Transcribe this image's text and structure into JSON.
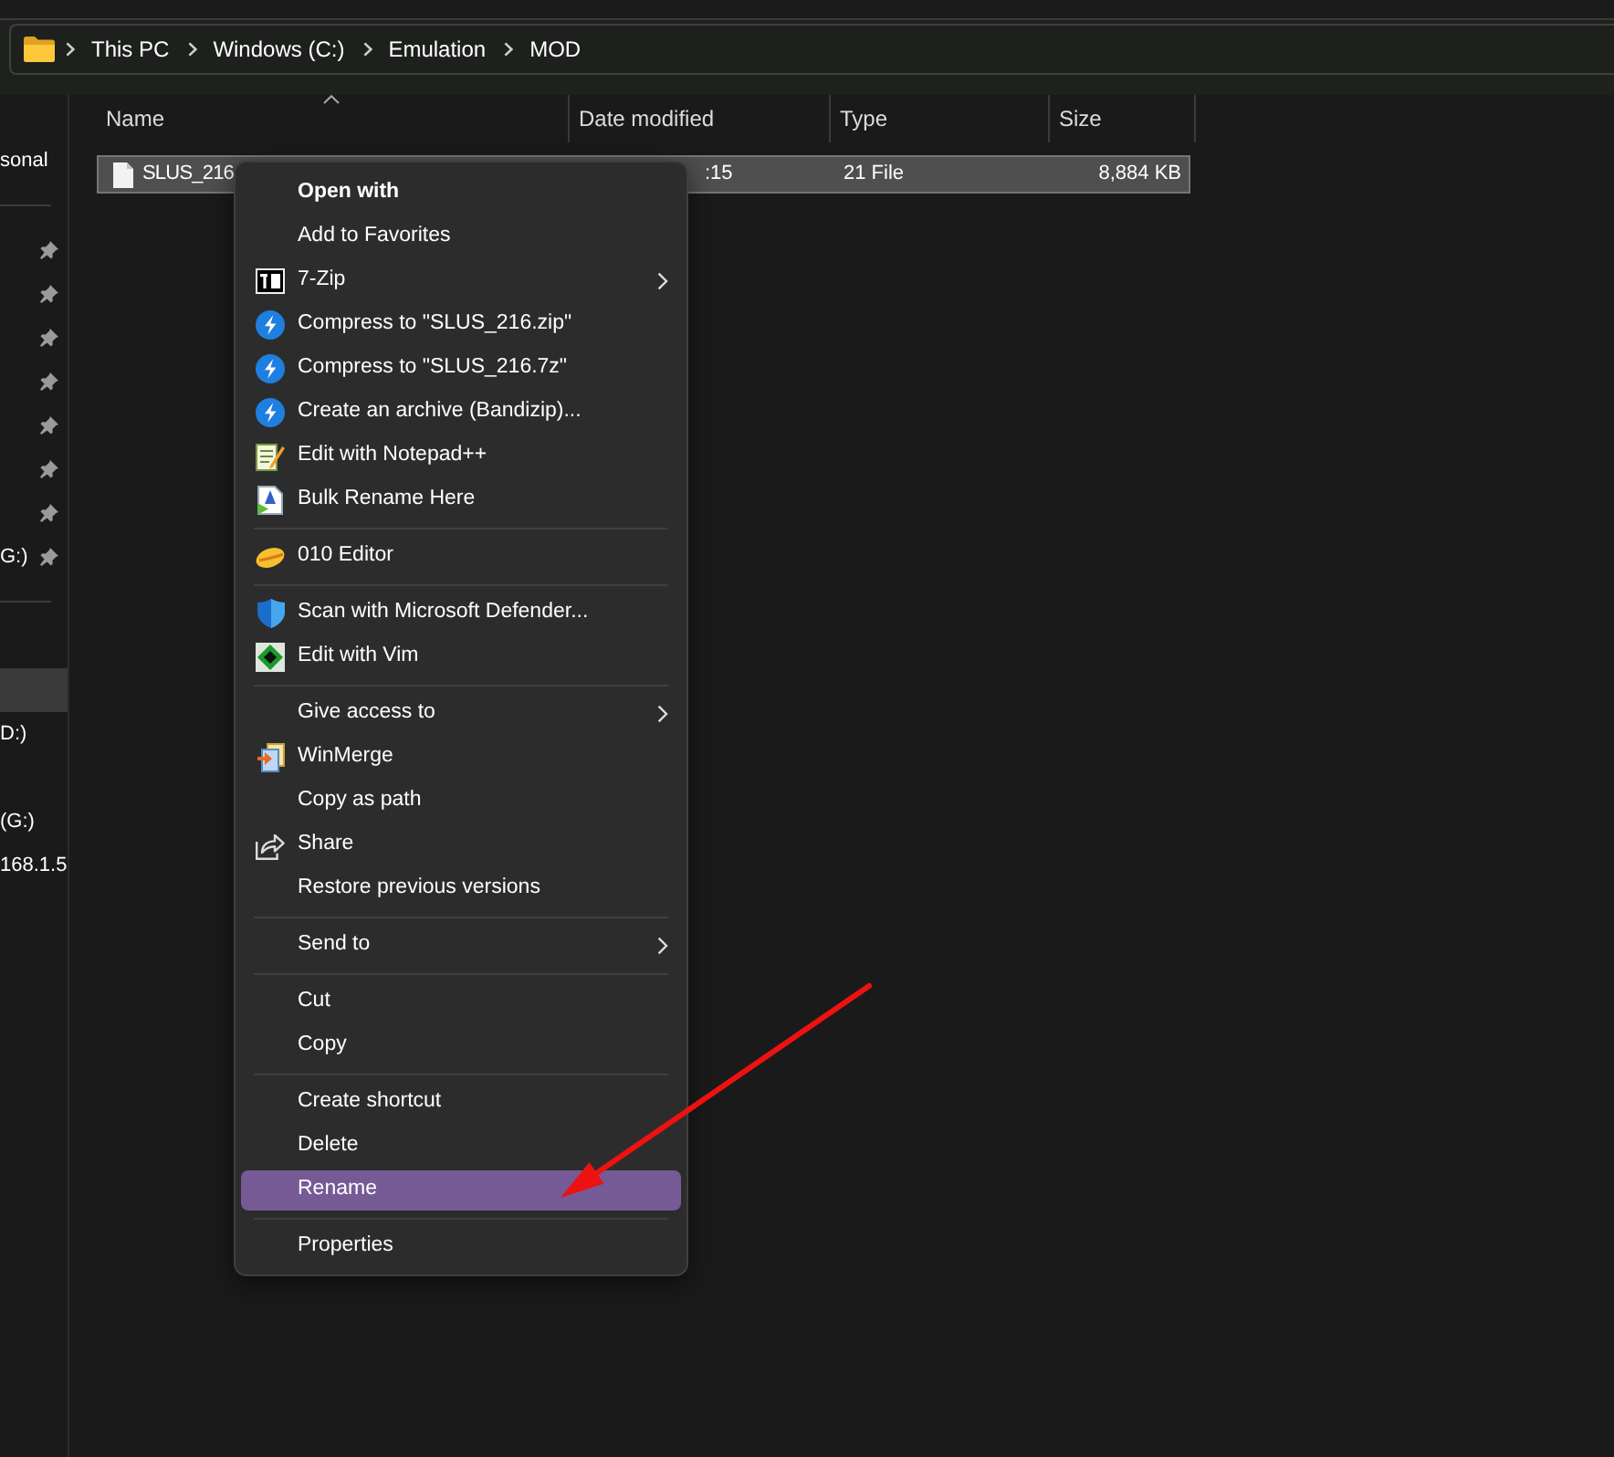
{
  "address_bar": {
    "crumbs": [
      "This PC",
      "Windows (C:)",
      "Emulation",
      "MOD"
    ]
  },
  "sidebar": {
    "sections": [
      {
        "items": [
          {
            "label": "sonal",
            "selected": false,
            "pinned": false
          }
        ]
      },
      {
        "items": [
          {
            "selected": false,
            "pinned": true
          },
          {
            "selected": false,
            "pinned": true
          },
          {
            "selected": false,
            "pinned": true
          },
          {
            "selected": false,
            "pinned": true
          },
          {
            "selected": false,
            "pinned": true
          },
          {
            "selected": false,
            "pinned": true
          },
          {
            "selected": false,
            "pinned": true
          },
          {
            "label": "G:)",
            "selected": false,
            "pinned": true
          }
        ]
      },
      {
        "items": [
          {
            "selected": false,
            "pinned": false
          },
          {
            "selected": true,
            "pinned": false
          },
          {
            "label": "D:)",
            "selected": false,
            "pinned": false
          },
          {
            "selected": false,
            "pinned": false
          },
          {
            "label": "(G:)",
            "selected": false,
            "pinned": false
          },
          {
            "label": "168.1.5",
            "selected": false,
            "pinned": false
          }
        ]
      }
    ]
  },
  "file_list": {
    "columns": [
      {
        "label": "Name",
        "sorted": true
      },
      {
        "label": "Date modified",
        "sorted": false
      },
      {
        "label": "Type",
        "sorted": false
      },
      {
        "label": "Size",
        "sorted": false
      }
    ],
    "rows": [
      {
        "selected": true,
        "cells": [
          "SLUS_216",
          ":15",
          "21 File",
          "8,884 KB"
        ]
      }
    ]
  },
  "context_menu": {
    "items": [
      {
        "kind": "default",
        "label": "Open with",
        "submenu": false,
        "selected": false
      },
      {
        "kind": "item",
        "label": "Add to Favorites",
        "submenu": false,
        "selected": false
      },
      {
        "kind": "item",
        "label": "7-Zip",
        "submenu": true,
        "selected": false
      },
      {
        "kind": "item",
        "label": "Compress to \"SLUS_216.zip\"",
        "submenu": false,
        "selected": false
      },
      {
        "kind": "item",
        "label": "Compress to \"SLUS_216.7z\"",
        "submenu": false,
        "selected": false
      },
      {
        "kind": "item",
        "label": "Create an archive (Bandizip)...",
        "submenu": false,
        "selected": false
      },
      {
        "kind": "item",
        "label": "Edit with Notepad++",
        "submenu": false,
        "selected": false
      },
      {
        "kind": "item",
        "label": "Bulk Rename Here",
        "submenu": false,
        "selected": false
      },
      {
        "kind": "separator"
      },
      {
        "kind": "item",
        "label": "010 Editor",
        "submenu": false,
        "selected": false
      },
      {
        "kind": "separator"
      },
      {
        "kind": "item",
        "label": "Scan with Microsoft Defender...",
        "submenu": false,
        "selected": false
      },
      {
        "kind": "item",
        "label": "Edit with Vim",
        "submenu": false,
        "selected": false
      },
      {
        "kind": "separator"
      },
      {
        "kind": "item",
        "label": "Give access to",
        "submenu": true,
        "selected": false
      },
      {
        "kind": "item",
        "label": "WinMerge",
        "submenu": false,
        "selected": false
      },
      {
        "kind": "item",
        "label": "Copy as path",
        "submenu": false,
        "selected": false
      },
      {
        "kind": "item",
        "label": "Share",
        "submenu": false,
        "selected": false
      },
      {
        "kind": "item",
        "label": "Restore previous versions",
        "submenu": false,
        "selected": false
      },
      {
        "kind": "separator"
      },
      {
        "kind": "item",
        "label": "Send to",
        "submenu": true,
        "selected": false
      },
      {
        "kind": "separator"
      },
      {
        "kind": "item",
        "label": "Cut",
        "submenu": false,
        "selected": false
      },
      {
        "kind": "item",
        "label": "Copy",
        "submenu": false,
        "selected": false
      },
      {
        "kind": "separator"
      },
      {
        "kind": "item",
        "label": "Create shortcut",
        "submenu": false,
        "selected": false
      },
      {
        "kind": "item",
        "label": "Delete",
        "submenu": false,
        "selected": false
      },
      {
        "kind": "item",
        "label": "Rename",
        "submenu": false,
        "selected": true
      },
      {
        "kind": "separator"
      },
      {
        "kind": "item",
        "label": "Properties",
        "submenu": false,
        "selected": false
      }
    ]
  },
  "annotations": [
    {
      "kind": "arrow"
    }
  ]
}
